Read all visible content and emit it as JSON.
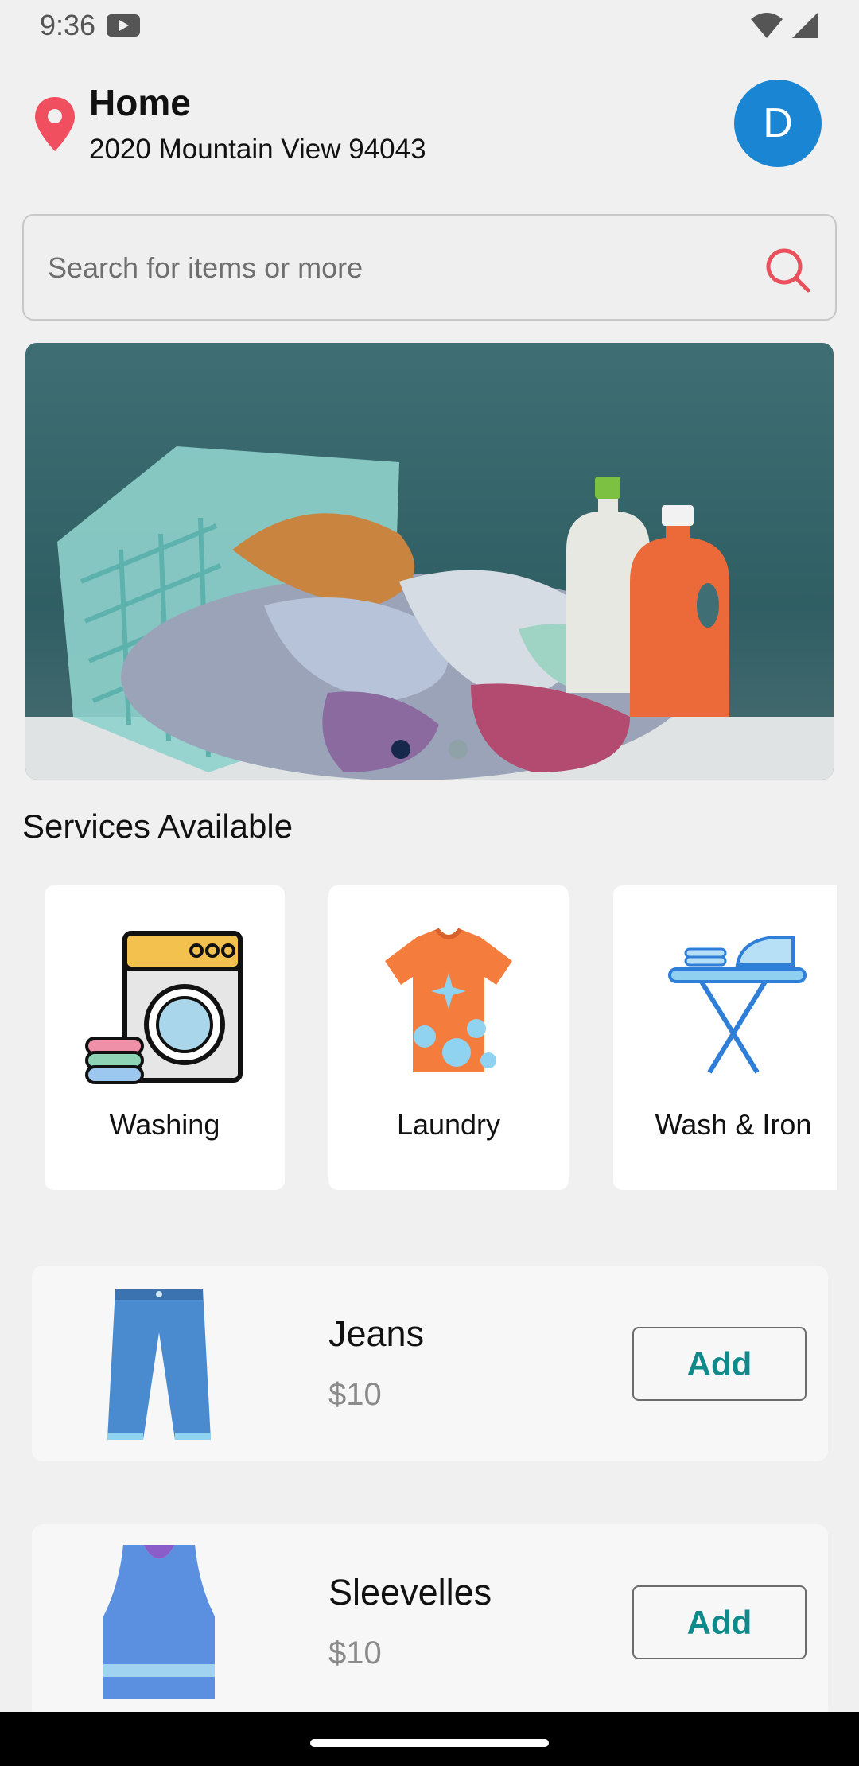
{
  "status_bar": {
    "time": "9:36"
  },
  "header": {
    "location_title": "Home",
    "location_address": "2020 Mountain View 94043",
    "avatar_letter": "D"
  },
  "search": {
    "placeholder": "Search for items or more"
  },
  "banner": {
    "slide_count": 2,
    "active_slide": 1
  },
  "services": {
    "title": "Services Available",
    "items": [
      {
        "label": "Washing",
        "icon": "washing-machine-icon"
      },
      {
        "label": "Laundry",
        "icon": "tshirt-bubbles-icon"
      },
      {
        "label": "Wash & Iron",
        "icon": "ironing-board-icon"
      }
    ]
  },
  "products": [
    {
      "name": "Jeans",
      "price": "$10",
      "button": "Add",
      "icon": "jeans-icon"
    },
    {
      "name": "Sleevelles",
      "price": "$10",
      "button": "Add",
      "icon": "tank-top-icon"
    }
  ],
  "colors": {
    "accent_teal": "#0f8a8a",
    "avatar_blue": "#1a85d3",
    "pin_red": "#ef4f5f",
    "search_icon_red": "#e8505b"
  }
}
